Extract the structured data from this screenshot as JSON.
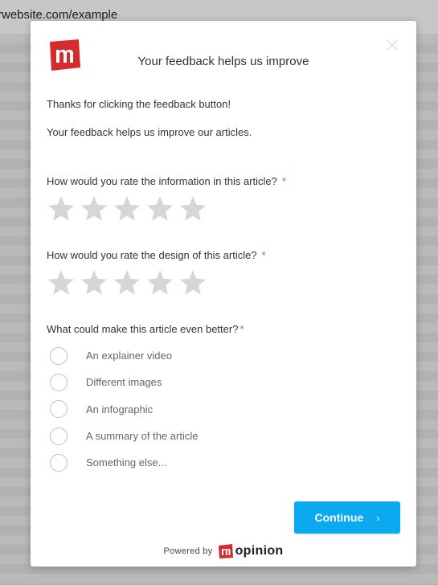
{
  "browser": {
    "url_fragment": "rwebsite.com/example"
  },
  "modal": {
    "title": "Your feedback helps us improve",
    "intro_line1": "Thanks for clicking the feedback button!",
    "intro_line2": "Your feedback helps us improve our articles.",
    "required_marker": "*",
    "q1": {
      "label": "How would you rate the information in this article?",
      "rating": 0,
      "max": 5
    },
    "q2": {
      "label": "How would you rate the design of this article?",
      "rating": 0,
      "max": 5
    },
    "q3": {
      "label": "What could make this article even better?",
      "options": [
        "An explainer video",
        "Different images",
        "An infographic",
        "A summary of the article",
        "Something else..."
      ]
    },
    "continue_label": "Continue",
    "continue_chevron": "›",
    "powered_by": "Powered by",
    "brand_name": "opinion"
  },
  "colors": {
    "accent": "#0aa9f0",
    "logo_red": "#d52b2b",
    "star_empty": "#d6d6d6",
    "required": "#2a9bb5"
  }
}
